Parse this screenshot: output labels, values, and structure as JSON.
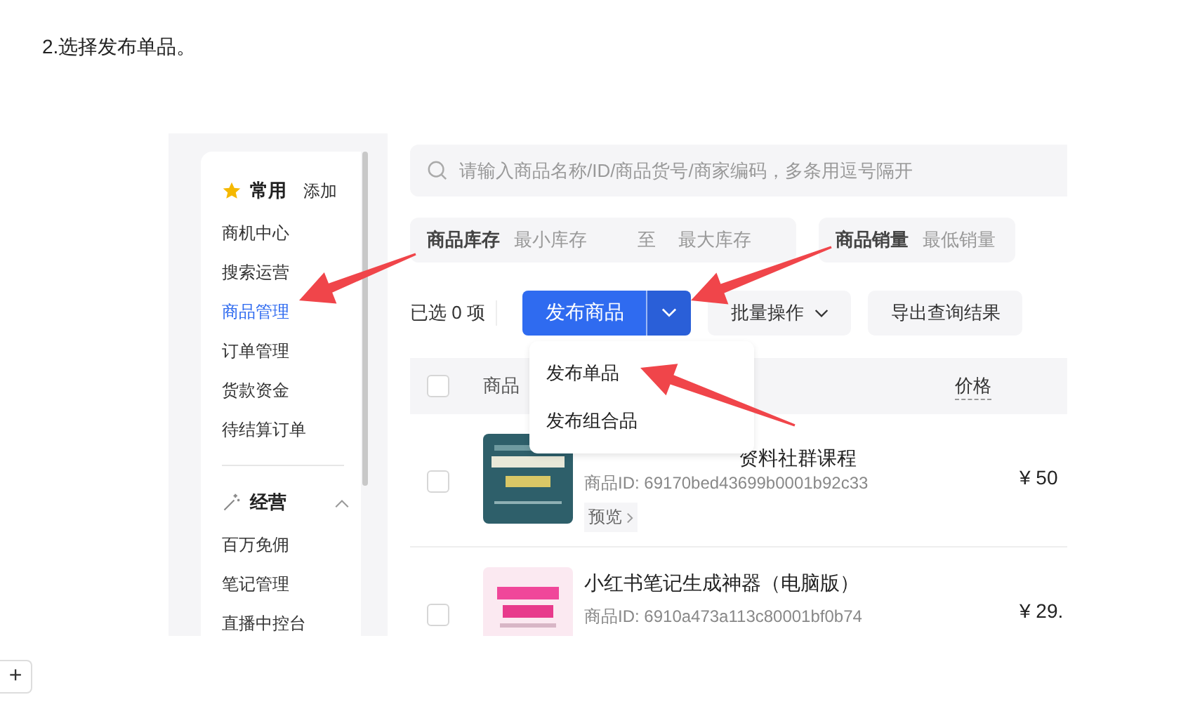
{
  "document": {
    "step_text": "2.选择发布单品。"
  },
  "sidebar": {
    "sections": [
      {
        "kind": "favorites",
        "title": "常用",
        "action": "添加",
        "items": [
          {
            "label": "商机中心",
            "selected": false
          },
          {
            "label": "搜索运营",
            "selected": false
          },
          {
            "label": "商品管理",
            "selected": true
          },
          {
            "label": "订单管理",
            "selected": false
          },
          {
            "label": "货款资金",
            "selected": false
          },
          {
            "label": "待结算订单",
            "selected": false
          }
        ]
      },
      {
        "kind": "group",
        "title": "经营",
        "expanded": true,
        "items": [
          {
            "label": "百万免佣",
            "selected": false
          },
          {
            "label": "笔记管理",
            "selected": false
          },
          {
            "label": "直播中控台",
            "selected": false
          }
        ]
      }
    ]
  },
  "search": {
    "placeholder": "请输入商品名称/ID/商品货号/商家编码，多条用逗号隔开"
  },
  "filters": [
    {
      "label": "商品库存",
      "min_placeholder": "最小库存",
      "separator": "至",
      "max_placeholder": "最大库存"
    },
    {
      "label": "商品销量",
      "min_placeholder": "最低销量"
    }
  ],
  "toolbar": {
    "selection": "已选 0 项",
    "publish_button": "发布商品",
    "batch_button": "批量操作",
    "export_button": "导出查询结果"
  },
  "publish_menu": {
    "items": [
      "发布单品",
      "发布组合品"
    ]
  },
  "table": {
    "header_checked": false,
    "columns": [
      "商品",
      "价格"
    ],
    "rows": [
      {
        "checked": false,
        "title": "资料社群课程",
        "product_id": "商品ID: 69170bed43699b0001b92c33",
        "preview": "预览",
        "price": "¥ 50"
      },
      {
        "checked": false,
        "title": "小红书笔记生成神器（电脑版）",
        "product_id": "商品ID: 6910a473a113c80001bf0b74",
        "price": "¥ 29."
      }
    ]
  },
  "add_button": "+"
}
